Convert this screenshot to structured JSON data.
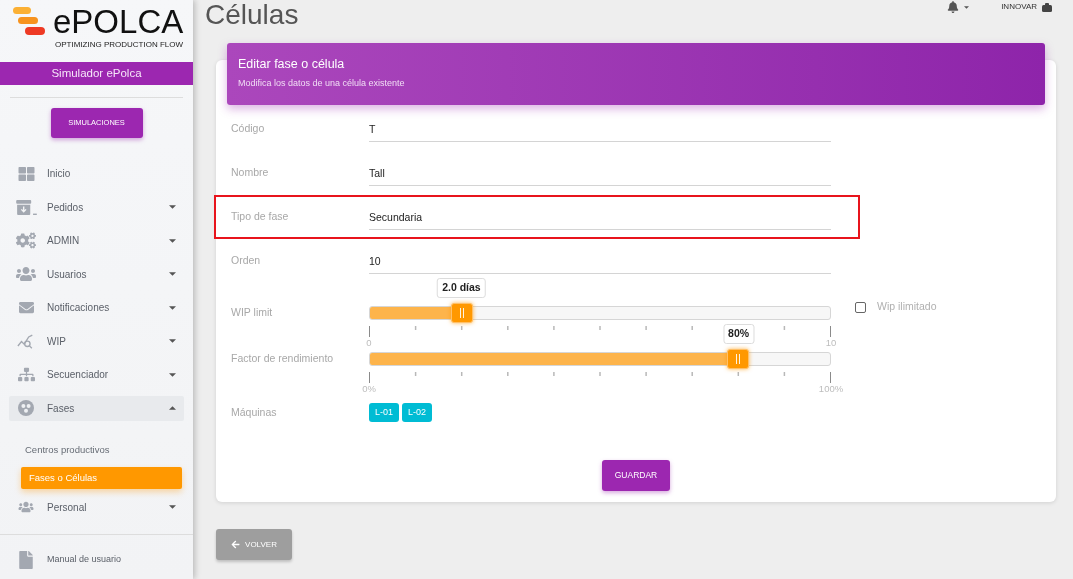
{
  "page": {
    "title": "Células"
  },
  "topbar": {
    "user": "INNOVAR"
  },
  "sidebar": {
    "logo": {
      "name": "ePOLCA",
      "tagline": "OPTIMIZING PRODUCTION FLOW"
    },
    "app_title": "Simulador ePolca",
    "primary_button": "SIMULACIONES",
    "items": [
      {
        "label": "Inicio",
        "kind": "link"
      },
      {
        "label": "Pedidos",
        "kind": "group",
        "expanded": false
      },
      {
        "label": "ADMIN",
        "kind": "group",
        "expanded": false
      },
      {
        "label": "Usuarios",
        "kind": "group",
        "expanded": false
      },
      {
        "label": "Notificaciones",
        "kind": "group",
        "expanded": false
      },
      {
        "label": "WIP",
        "kind": "group",
        "expanded": false
      },
      {
        "label": "Secuenciador",
        "kind": "group",
        "expanded": false
      },
      {
        "label": "Fases",
        "kind": "group",
        "expanded": true,
        "children": [
          {
            "label": "Centros productivos",
            "selected": false
          },
          {
            "label": "Fases o Células",
            "selected": true
          }
        ]
      },
      {
        "label": "Personal",
        "kind": "group",
        "expanded": false
      }
    ],
    "footer_items": [
      {
        "label": "Manual de usuario"
      }
    ]
  },
  "form": {
    "title": "Editar fase o célula",
    "subtitle": "Modifica los datos de una célula existente",
    "fields": [
      {
        "label": "Código",
        "value": "T",
        "highlighted": false
      },
      {
        "label": "Nombre",
        "value": "Tall",
        "highlighted": false
      },
      {
        "label": "Tipo de fase",
        "value": "Secundaria",
        "highlighted": true
      },
      {
        "label": "Orden",
        "value": "10",
        "highlighted": false
      }
    ],
    "sliders": [
      {
        "label": "WIP limit",
        "level": 0.2,
        "tooltip": "2.0 días",
        "min_label": "0",
        "max_label": "10",
        "checkbox": {
          "label": "Wip ilimitado",
          "checked": false
        }
      },
      {
        "label": "Factor de rendimiento",
        "level": 0.8,
        "tooltip": "80%",
        "min_label": "0%",
        "max_label": "100%"
      }
    ],
    "machines": {
      "label": "Máquinas",
      "chips": [
        "L-01",
        "L-02"
      ]
    },
    "save_button": "GUARDAR"
  },
  "back_button": "VOLVER"
}
